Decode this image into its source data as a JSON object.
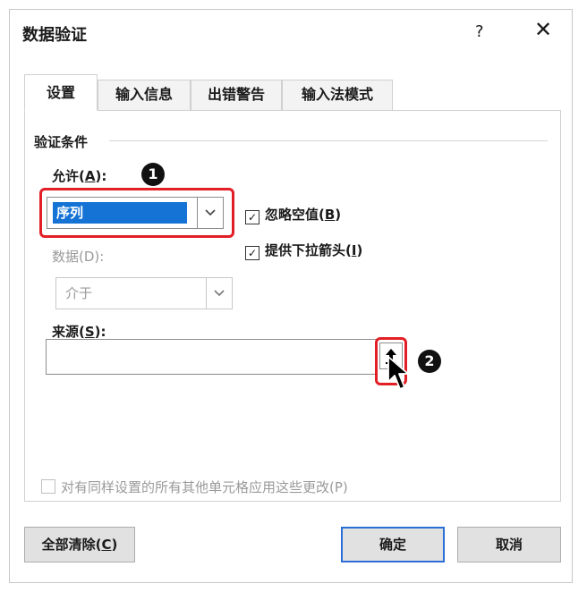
{
  "dialog": {
    "title": "数据验证",
    "help_label": "?",
    "close_label": "✕"
  },
  "tabs": [
    {
      "label": "设置",
      "active": true
    },
    {
      "label": "输入信息",
      "active": false
    },
    {
      "label": "出错警告",
      "active": false
    },
    {
      "label": "输入法模式",
      "active": false
    }
  ],
  "settings": {
    "section_title": "验证条件",
    "allow_label": "允许(",
    "allow_mnemonic": "A",
    "allow_label_end": "):",
    "allow_value": "序列",
    "ignore_blank_label": "忽略空值(",
    "ignore_blank_mnemonic": "B",
    "ignore_blank_end": ")",
    "ignore_blank_checked": "☑",
    "dropdown_label": "提供下拉箭头(",
    "dropdown_mnemonic": "I",
    "dropdown_end": ")",
    "dropdown_checked": "☑",
    "data_label": "数据(D):",
    "data_value": "介于",
    "source_label": "来源(",
    "source_mnemonic": "S",
    "source_label_end": "):",
    "source_value": "",
    "apply_all_label": "对有同样设置的所有其他单元格应用这些更改(P)"
  },
  "callouts": {
    "one": "1",
    "two": "2"
  },
  "buttons": {
    "clear_all": "全部清除(",
    "clear_all_mnemonic": "C",
    "clear_all_end": ")",
    "ok": "确定",
    "cancel": "取消"
  },
  "icons": {
    "collapse": "upload-arrow-icon",
    "cursor": "mouse-pointer-icon",
    "dropdown": "chevron-down-icon"
  },
  "colors": {
    "highlight": "#1673d6",
    "annotation_red": "#e21f26"
  }
}
